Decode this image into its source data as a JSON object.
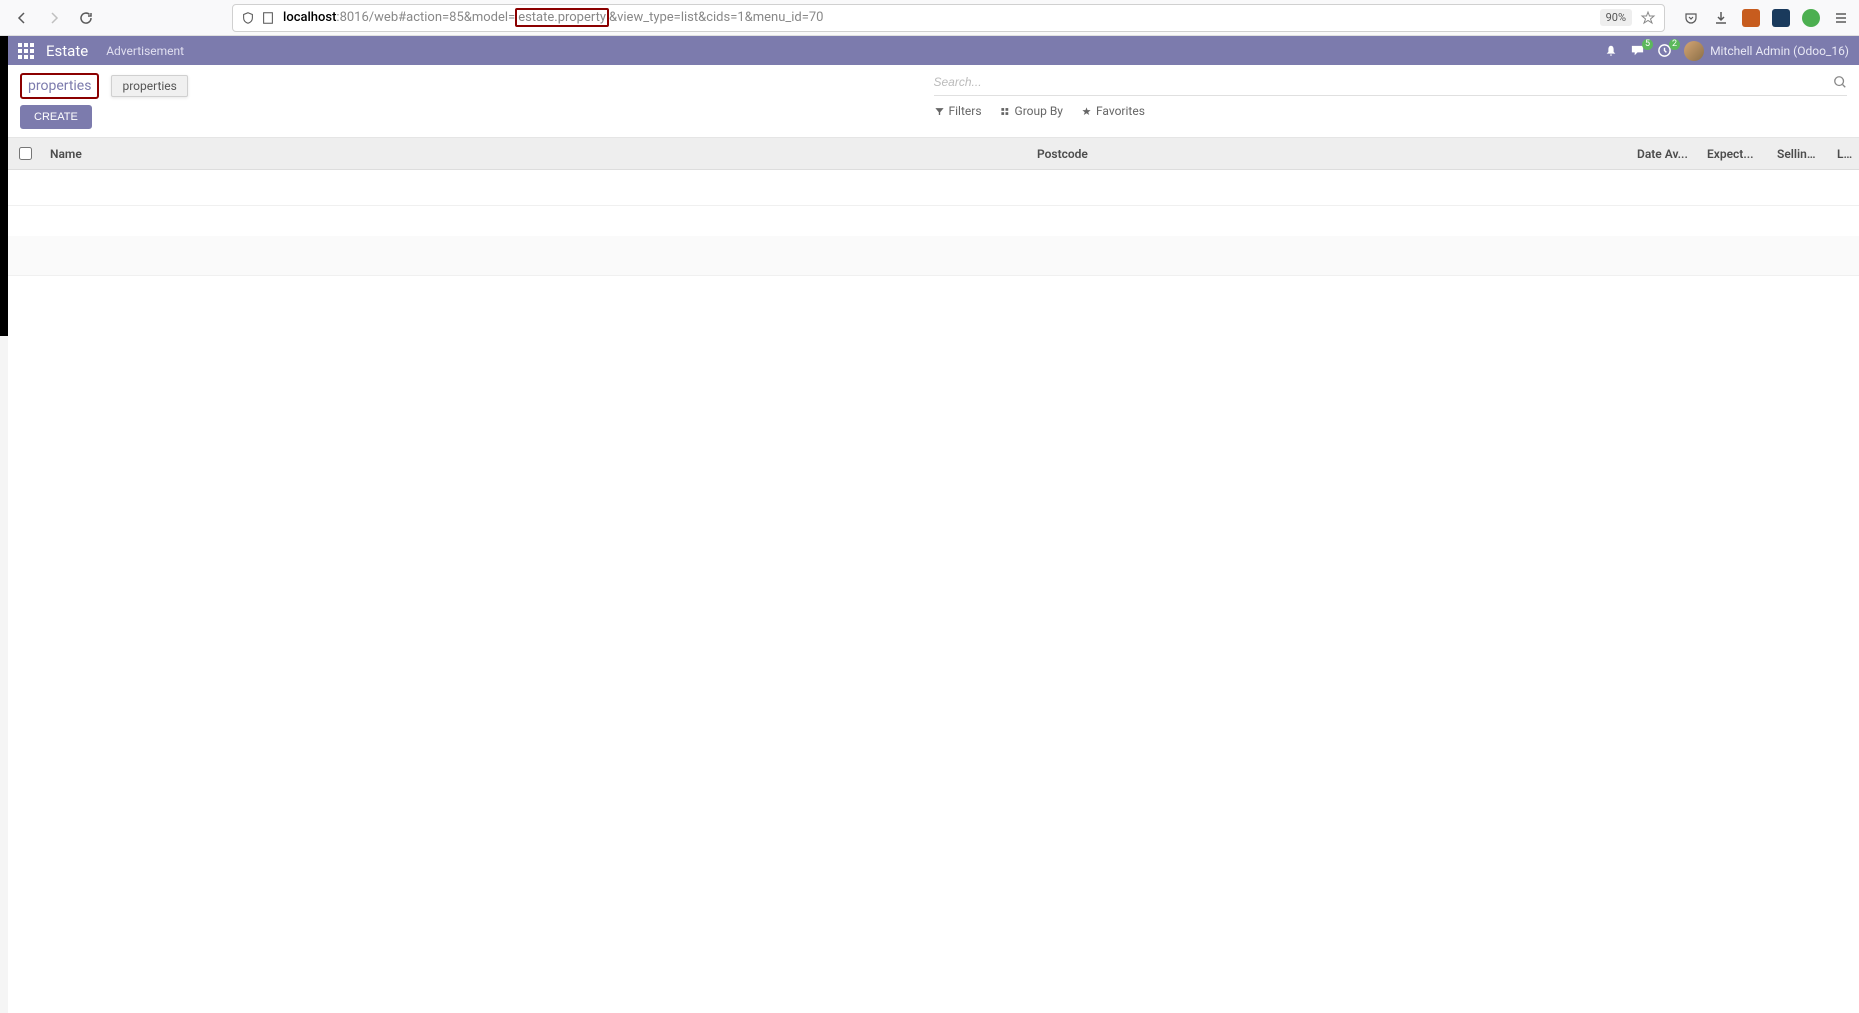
{
  "browser": {
    "url_prefix": "localhost",
    "url_mid1": ":8016/web#action=85&model=",
    "url_highlight": "estate.property",
    "url_mid2": "&view_type=list&cids=1&menu_id=70",
    "zoom": "90%"
  },
  "nav": {
    "app_name": "Estate",
    "menu_item": "Advertisement",
    "chat_badge": "5",
    "activity_badge": "2",
    "user_name": "Mitchell Admin (Odoo_16)"
  },
  "control_panel": {
    "breadcrumb": "properties",
    "tooltip": "properties",
    "create_label": "CREATE",
    "search_placeholder": "Search...",
    "filters_label": "Filters",
    "groupby_label": "Group By",
    "favorites_label": "Favorites"
  },
  "table": {
    "columns": {
      "name": "Name",
      "postcode": "Postcode",
      "date_av": "Date Av...",
      "expect": "Expect...",
      "selling": "Selling ...",
      "li": "Li..."
    }
  }
}
